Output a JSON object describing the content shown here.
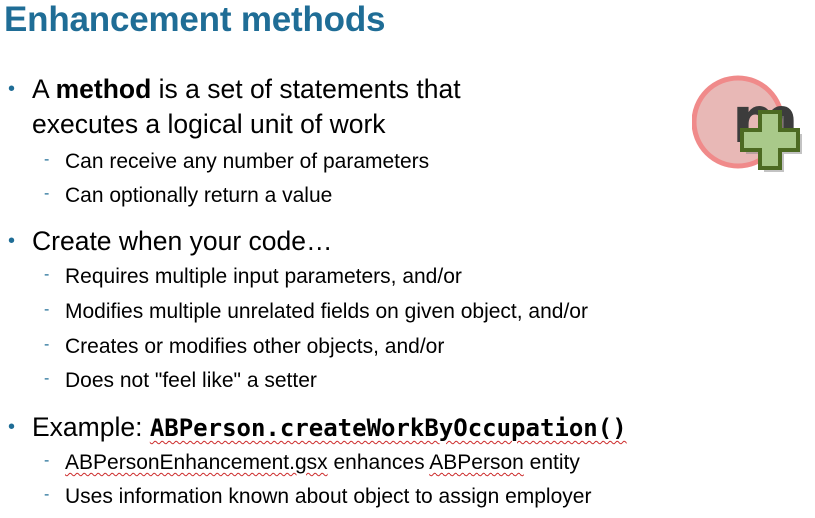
{
  "title": "Enhancement methods",
  "bullets": [
    {
      "line1_prefix": "A ",
      "line1_bold": "method",
      "line1_suffix": " is a set of statements that",
      "line2": "executes a logical unit of work",
      "subs": [
        "Can receive any number of parameters",
        "Can optionally return a value"
      ]
    },
    {
      "text": "Create when your code…",
      "subs": [
        "Requires multiple input parameters, and/or",
        "Modifies multiple unrelated fields on given object, and/or",
        "Creates or modifies other objects, and/or",
        "Does not \"feel like\" a setter"
      ]
    },
    {
      "prefix": "Example: ",
      "code": "ABPerson.createWorkByOccupation()",
      "subs": [
        {
          "a": "ABPersonEnhancement.gsx",
          "b": " enhances ",
          "c": "ABPerson",
          "d": " entity"
        },
        "Uses information known about object to assign employer"
      ]
    }
  ],
  "bullet_glyph": "•",
  "sub_glyph": "-",
  "logo": {
    "icon": "method-plus-icon",
    "letter": "m",
    "colors": {
      "circle": "#f08a8a",
      "cross": "#a9c98a",
      "cross_border": "#4c6a22",
      "letter": "#3c3c3c"
    }
  }
}
